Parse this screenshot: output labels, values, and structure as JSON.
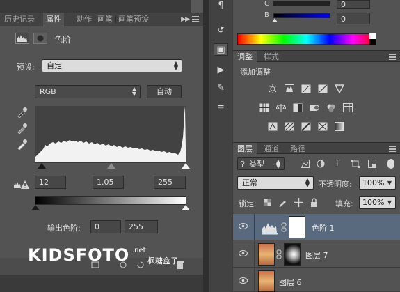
{
  "left_panel": {
    "tabs": [
      "历史记录",
      "属性",
      "动作",
      "画笔",
      "画笔预设"
    ],
    "title": "色阶",
    "preset_label": "预设:",
    "preset_value": "自定",
    "channel_value": "RGB",
    "auto_button": "自动",
    "input_black": "12",
    "input_gamma": "1.05",
    "input_white": "255",
    "output_label": "输出色阶:",
    "output_black": "0",
    "output_white": "255"
  },
  "color_panel": {
    "g_label": "G",
    "b_label": "B",
    "g_value": "0",
    "b_value": "0"
  },
  "adjustments_panel": {
    "tabs": [
      "调整",
      "样式"
    ],
    "title": "添加调整"
  },
  "layers_panel": {
    "tabs": [
      "图层",
      "通道",
      "路径"
    ],
    "filter_type": "类型",
    "blend_mode": "正常",
    "opacity_label": "不透明度:",
    "opacity_value": "100%",
    "lock_label": "锁定:",
    "fill_label": "填充:",
    "fill_value": "100%",
    "layers": [
      {
        "name": "色阶 1"
      },
      {
        "name": "图层 7"
      },
      {
        "name": "图层 6"
      }
    ]
  },
  "watermark": {
    "brand": "KIDSFOTO",
    "suffix": ".net",
    "cn": "枫糖盒子"
  },
  "colors": {
    "panel_bg": "#535353",
    "dark_bg": "#424242",
    "selected_layer": "#5a6a7e"
  }
}
